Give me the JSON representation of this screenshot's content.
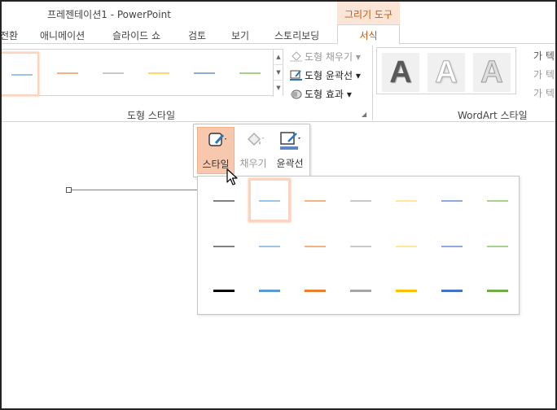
{
  "app": {
    "title": "프레젠테이션1 - PowerPoint",
    "context_group": "그리기 도구"
  },
  "tabs": [
    {
      "label": "전환"
    },
    {
      "label": "애니메이션"
    },
    {
      "label": "슬라이드 쇼"
    },
    {
      "label": "검토"
    },
    {
      "label": "보기"
    },
    {
      "label": "스토리보딩"
    },
    {
      "label": "서식",
      "active": true
    }
  ],
  "ribbon": {
    "shape_styles_label": "도형 스타일",
    "shape_fill": "도형 채우기",
    "shape_outline": "도형 윤곽선",
    "shape_effects": "도형 효과",
    "wordart_label": "WordArt 스타일",
    "wordart_letter": "A",
    "wordart_side": [
      "가",
      "가",
      "가"
    ],
    "wordart_side_suffix": [
      "텍",
      "텍",
      "텍"
    ],
    "gallery_colors": [
      "#9dc3e6",
      "#f4b183",
      "#c9c9c9",
      "#ffd966",
      "#8faadc",
      "#a9d18e"
    ]
  },
  "mini_toolbar": {
    "style": "스타일",
    "fill": "채우기",
    "outline": "윤곽선"
  },
  "style_gallery": {
    "rows": [
      [
        "#7f7f7f",
        "#9dc3e6",
        "#f4b183",
        "#c9c9c9",
        "#ffe699",
        "#8faadc",
        "#a9d18e"
      ],
      [
        "#7f7f7f",
        "#9dc3e6",
        "#f4b183",
        "#c9c9c9",
        "#ffe699",
        "#8faadc",
        "#a9d18e"
      ],
      [
        "#000000",
        "#5b9bd5",
        "#ed7d31",
        "#a5a5a5",
        "#ffc000",
        "#4472c4",
        "#70ad47"
      ]
    ],
    "selected": [
      0,
      1
    ]
  }
}
